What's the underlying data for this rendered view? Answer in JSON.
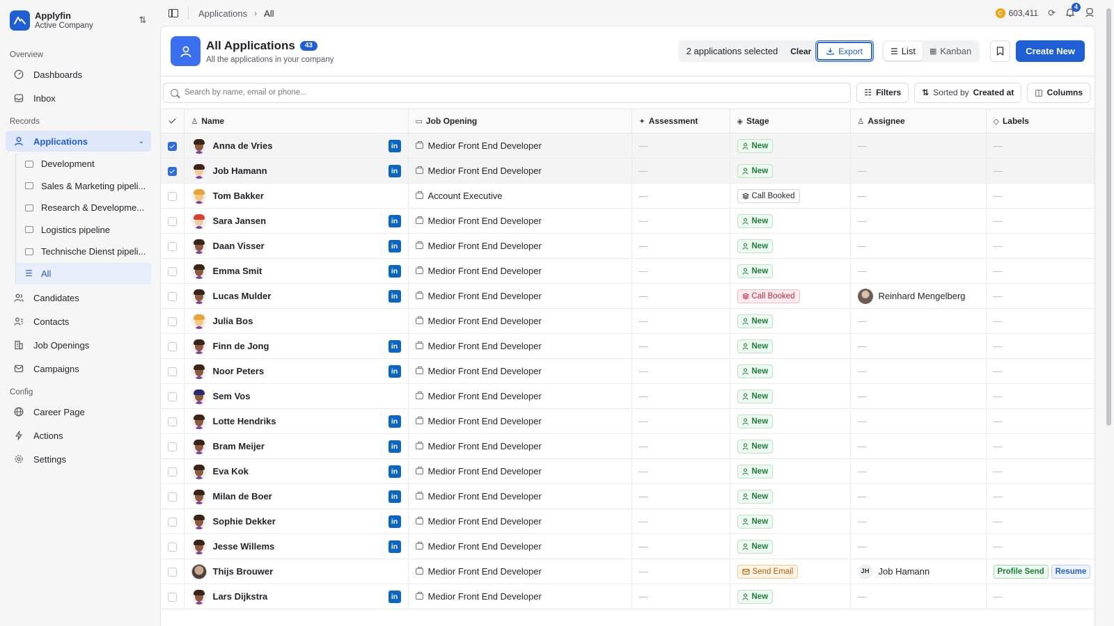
{
  "brand": {
    "name": "Applyfin",
    "subtitle": "Active Company"
  },
  "sidebar": {
    "overview_label": "Overview",
    "overview_items": [
      {
        "label": "Dashboards",
        "icon": "gauge-icon"
      },
      {
        "label": "Inbox",
        "icon": "inbox-icon"
      }
    ],
    "records_label": "Records",
    "applications_label": "Applications",
    "pipelines": [
      "Development",
      "Sales & Marketing pipeli...",
      "Research & Developme...",
      "Logistics pipeline",
      "Technische Dienst pipeli...",
      "All"
    ],
    "records_items": [
      {
        "label": "Candidates",
        "icon": "users-icon"
      },
      {
        "label": "Contacts",
        "icon": "contacts-icon"
      },
      {
        "label": "Job Openings",
        "icon": "building-icon"
      },
      {
        "label": "Campaigns",
        "icon": "mail-icon"
      }
    ],
    "config_label": "Config",
    "config_items": [
      {
        "label": "Career Page",
        "icon": "globe-icon"
      },
      {
        "label": "Actions",
        "icon": "bolt-icon"
      },
      {
        "label": "Settings",
        "icon": "gear-icon"
      }
    ]
  },
  "breadcrumb": {
    "parent": "Applications",
    "current": "All"
  },
  "topbar": {
    "credits": "603,411",
    "notification_count": "4"
  },
  "header": {
    "title": "All Applications",
    "count": "43",
    "subtitle": "All the applications in your company",
    "selection_text": "2 applications selected",
    "clear_label": "Clear",
    "export_label": "Export",
    "view_list": "List",
    "view_kanban": "Kanban",
    "create_label": "Create New"
  },
  "toolbar": {
    "search_placeholder": "Search by name, email or phone...",
    "filters_label": "Filters",
    "sorted_prefix": "Sorted by",
    "sorted_field": "Created at",
    "columns_label": "Columns"
  },
  "columns": [
    "Name",
    "Job Opening",
    "Assessment",
    "Stage",
    "Assignee",
    "Labels"
  ],
  "empty": "—",
  "rows": [
    {
      "name": "Anna de Vries",
      "linkedin": true,
      "job": "Medior Front End Developer",
      "stage": "New",
      "stage_type": "new",
      "assignee": "",
      "selected": true,
      "avatar": "a"
    },
    {
      "name": "Job Hamann",
      "linkedin": true,
      "job": "Medior Front End Developer",
      "stage": "New",
      "stage_type": "new",
      "assignee": "",
      "selected": true,
      "avatar": "b"
    },
    {
      "name": "Tom Bakker",
      "linkedin": false,
      "job": "Account Executive",
      "stage": "Call Booked",
      "stage_type": "booked",
      "assignee": "",
      "selected": false,
      "avatar": "c"
    },
    {
      "name": "Sara Jansen",
      "linkedin": true,
      "job": "Medior Front End Developer",
      "stage": "New",
      "stage_type": "new",
      "assignee": "",
      "selected": false,
      "avatar": "d"
    },
    {
      "name": "Daan Visser",
      "linkedin": true,
      "job": "Medior Front End Developer",
      "stage": "New",
      "stage_type": "new",
      "assignee": "",
      "selected": false,
      "avatar": "a"
    },
    {
      "name": "Emma Smit",
      "linkedin": true,
      "job": "Medior Front End Developer",
      "stage": "New",
      "stage_type": "new",
      "assignee": "",
      "selected": false,
      "avatar": "a"
    },
    {
      "name": "Lucas Mulder",
      "linkedin": true,
      "job": "Medior Front End Developer",
      "stage": "Call Booked",
      "stage_type": "booked-red",
      "assignee": "Reinhard Mengelberg",
      "assignee_type": "photo",
      "selected": false,
      "avatar": "a"
    },
    {
      "name": "Julia Bos",
      "linkedin": false,
      "job": "Medior Front End Developer",
      "stage": "New",
      "stage_type": "new",
      "assignee": "",
      "selected": false,
      "avatar": "c"
    },
    {
      "name": "Finn de Jong",
      "linkedin": true,
      "job": "Medior Front End Developer",
      "stage": "New",
      "stage_type": "new",
      "assignee": "",
      "selected": false,
      "avatar": "a"
    },
    {
      "name": "Noor Peters",
      "linkedin": true,
      "job": "Medior Front End Developer",
      "stage": "New",
      "stage_type": "new",
      "assignee": "",
      "selected": false,
      "avatar": "a"
    },
    {
      "name": "Sem Vos",
      "linkedin": false,
      "job": "Medior Front End Developer",
      "stage": "New",
      "stage_type": "new",
      "assignee": "",
      "selected": false,
      "avatar": "e"
    },
    {
      "name": "Lotte Hendriks",
      "linkedin": true,
      "job": "Medior Front End Developer",
      "stage": "New",
      "stage_type": "new",
      "assignee": "",
      "selected": false,
      "avatar": "a"
    },
    {
      "name": "Bram Meijer",
      "linkedin": true,
      "job": "Medior Front End Developer",
      "stage": "New",
      "stage_type": "new",
      "assignee": "",
      "selected": false,
      "avatar": "a"
    },
    {
      "name": "Eva Kok",
      "linkedin": true,
      "job": "Medior Front End Developer",
      "stage": "New",
      "stage_type": "new",
      "assignee": "",
      "selected": false,
      "avatar": "a"
    },
    {
      "name": "Milan de Boer",
      "linkedin": true,
      "job": "Medior Front End Developer",
      "stage": "New",
      "stage_type": "new",
      "assignee": "",
      "selected": false,
      "avatar": "a"
    },
    {
      "name": "Sophie Dekker",
      "linkedin": true,
      "job": "Medior Front End Developer",
      "stage": "New",
      "stage_type": "new",
      "assignee": "",
      "selected": false,
      "avatar": "a"
    },
    {
      "name": "Jesse Willems",
      "linkedin": true,
      "job": "Medior Front End Developer",
      "stage": "New",
      "stage_type": "new",
      "assignee": "",
      "selected": false,
      "avatar": "a"
    },
    {
      "name": "Thijs Brouwer",
      "linkedin": false,
      "job": "Medior Front End Developer",
      "stage": "Send Email",
      "stage_type": "email",
      "assignee": "Job Hamann",
      "assignee_type": "initials",
      "assignee_initials": "JH",
      "labels": [
        "Profile Send",
        "Resume"
      ],
      "selected": false,
      "avatar": "f"
    },
    {
      "name": "Lars Dijkstra",
      "linkedin": true,
      "job": "Medior Front End Developer",
      "stage": "New",
      "stage_type": "new",
      "assignee": "",
      "selected": false,
      "avatar": "a"
    }
  ],
  "colors": {
    "accent": "#1f5fd6",
    "linkedin": "#0a66c2",
    "stage_new": "#1a7f37",
    "stage_booked_red": "#c9263f",
    "stage_email": "#b95c00"
  }
}
